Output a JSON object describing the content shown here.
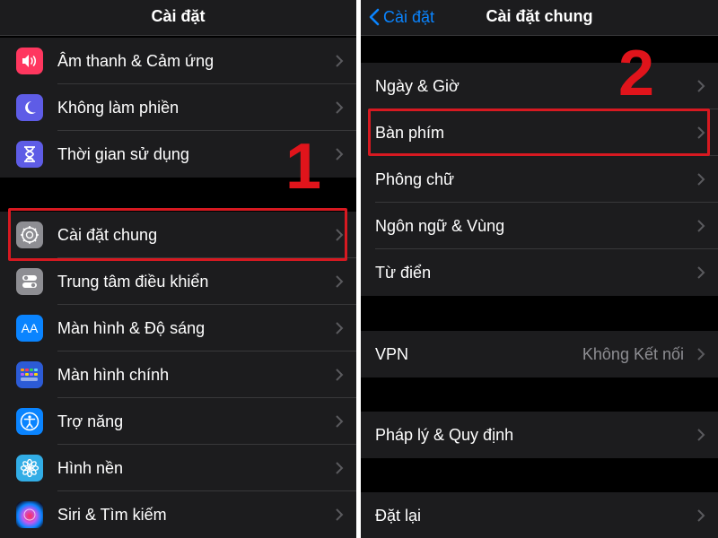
{
  "left": {
    "nav_title": "Cài đặt",
    "group1": [
      {
        "label": "Âm thanh & Cảm ứng",
        "icon": "sound-icon",
        "color": "#ff375f"
      },
      {
        "label": "Không làm phiền",
        "icon": "moon-icon",
        "color": "#5e5ce6"
      },
      {
        "label": "Thời gian sử dụng",
        "icon": "hourglass-icon",
        "color": "#5e5ce6"
      }
    ],
    "group2": [
      {
        "label": "Cài đặt chung",
        "icon": "gear-icon",
        "color": "#8e8e93"
      },
      {
        "label": "Trung tâm điều khiển",
        "icon": "toggles-icon",
        "color": "#8e8e93"
      },
      {
        "label": "Màn hình & Độ sáng",
        "icon": "text-size-icon",
        "color": "#0a84ff",
        "icon_text": "AA"
      },
      {
        "label": "Màn hình chính",
        "icon": "home-grid-icon",
        "color": "#2c5bd6"
      },
      {
        "label": "Trợ năng",
        "icon": "accessibility-icon",
        "color": "#0a84ff"
      },
      {
        "label": "Hình nền",
        "icon": "flower-icon",
        "color": "#32ade6"
      },
      {
        "label": "Siri & Tìm kiếm",
        "icon": "siri-icon",
        "color": "#1c1c3a"
      }
    ],
    "step": "1"
  },
  "right": {
    "back_label": "Cài đặt",
    "nav_title": "Cài đặt chung",
    "group1": [
      "Ngày & Giờ",
      "Bàn phím",
      "Phông chữ",
      "Ngôn ngữ & Vùng",
      "Từ điển"
    ],
    "vpn": {
      "label": "VPN",
      "value": "Không Kết nối"
    },
    "legal": "Pháp lý & Quy định",
    "reset": "Đặt lại",
    "step": "2"
  },
  "colors": {
    "accent": "#0a84ff",
    "highlight": "#d71921",
    "cell_bg": "#1c1c1e",
    "background": "#000000"
  }
}
